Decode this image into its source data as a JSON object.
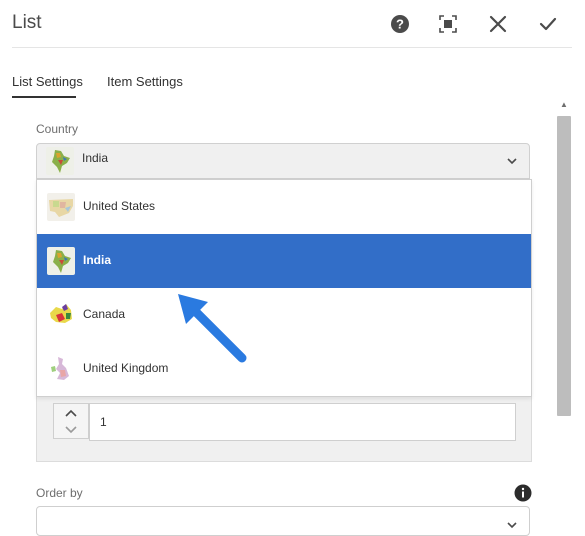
{
  "dialog": {
    "title": "List",
    "icons": [
      "help-icon",
      "fullscreen-icon",
      "close-icon",
      "done-check-icon"
    ]
  },
  "tabs": [
    {
      "label": "List Settings",
      "active": true
    },
    {
      "label": "Item Settings",
      "active": false
    }
  ],
  "country": {
    "label": "Country",
    "selected": "India",
    "options": [
      {
        "label": "United States",
        "icon": "us-map-icon"
      },
      {
        "label": "India",
        "icon": "india-map-icon",
        "selected": true
      },
      {
        "label": "Canada",
        "icon": "canada-map-icon"
      },
      {
        "label": "United Kingdom",
        "icon": "uk-map-icon"
      }
    ]
  },
  "stepper": {
    "value": "1"
  },
  "order_by": {
    "label": "Order by",
    "icon": "info-icon"
  },
  "colors": {
    "accent": "#326ec8",
    "arrow": "#2a7ae0"
  }
}
